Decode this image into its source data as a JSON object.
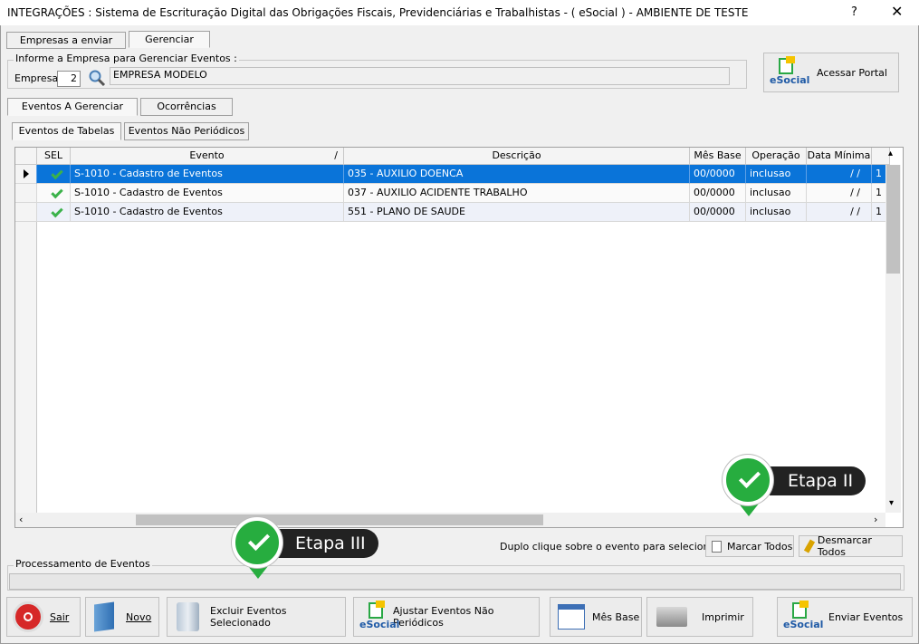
{
  "window": {
    "title": "INTEGRAÇÕES : Sistema de Escrituração Digital das Obrigações Fiscais, Previdenciárias e Trabalhistas - ( eSocial ) - AMBIENTE DE TESTE",
    "help": "?",
    "close": "✕"
  },
  "top_tabs": [
    {
      "label": "Empresas a enviar"
    },
    {
      "label": "Gerenciar"
    }
  ],
  "empresa_group": {
    "legend": "Informe a Empresa para Gerenciar Eventos :",
    "label": "Empresa",
    "code": "2",
    "name": "EMPRESA MODELO"
  },
  "portal_button": {
    "label": "Acessar Portal",
    "logo": "eSocial"
  },
  "sub_tabs": [
    {
      "label": "Eventos A Gerenciar"
    },
    {
      "label": "Ocorrências"
    }
  ],
  "event_tabs": [
    {
      "label": "Eventos de Tabelas"
    },
    {
      "label": "Eventos Não Periódicos"
    }
  ],
  "grid": {
    "columns": [
      "SEL",
      "Evento",
      "/",
      "Descrição",
      "Mês Base",
      "Operação",
      "Data Mínima"
    ],
    "rows": [
      {
        "evento": "S-1010 - Cadastro de Eventos",
        "descricao": "035 - AUXILIO DOENCA",
        "mes_base": "00/0000",
        "operacao": "inclusao",
        "data_minima": "/ /",
        "extra": "1"
      },
      {
        "evento": "S-1010 - Cadastro de Eventos",
        "descricao": "037 - AUXILIO ACIDENTE TRABALHO",
        "mes_base": "00/0000",
        "operacao": "inclusao",
        "data_minima": "/ /",
        "extra": "1"
      },
      {
        "evento": "S-1010 - Cadastro de Eventos",
        "descricao": "551 - PLANO DE SAUDE",
        "mes_base": "00/0000",
        "operacao": "inclusao",
        "data_minima": "/ /",
        "extra": "1"
      }
    ]
  },
  "hint": "Duplo clique sobre o evento para selecioná-lo.",
  "marcar_todos": "Marcar Todos",
  "desmarcar_todos": "Desmarcar Todos",
  "callouts": [
    {
      "label": "Etapa II"
    },
    {
      "label": "Etapa III"
    }
  ],
  "processamento": {
    "legend": "Processamento de Eventos",
    "progress": 0
  },
  "bottom_buttons": [
    {
      "label": "Sair"
    },
    {
      "label": "Novo"
    },
    {
      "label": "Excluir Eventos Selecionado"
    },
    {
      "label": "Ajustar Eventos Não Periódicos"
    },
    {
      "label": "Mês Base"
    },
    {
      "label": "Imprimir"
    },
    {
      "label": "Enviar Eventos"
    }
  ],
  "colors": {
    "selection": "#0a74d9",
    "callout_green": "#27ad3f",
    "callout_label": "#222222"
  }
}
